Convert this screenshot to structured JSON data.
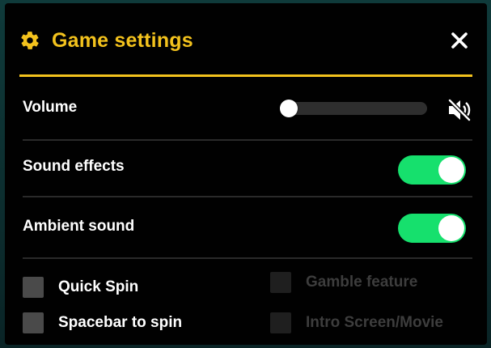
{
  "colors": {
    "accent": "#f3c21d",
    "toggle_on": "#16e06d",
    "panel_bg": "#010101",
    "checkbox_enabled": "#4a4a4a",
    "checkbox_disabled": "#1f1f1f",
    "label_disabled": "#3d3d3d"
  },
  "header": {
    "title": "Game settings",
    "icon": "gear-icon",
    "close_icon": "close-icon"
  },
  "settings": {
    "volume": {
      "label": "Volume",
      "level_percent": 0,
      "muted": true,
      "mute_icon": "speaker-muted-icon"
    },
    "sound_effects": {
      "label": "Sound effects",
      "on": true
    },
    "ambient_sound": {
      "label": "Ambient sound",
      "on": true
    }
  },
  "options": {
    "quick_spin": {
      "label": "Quick Spin",
      "checked": false,
      "enabled": true
    },
    "spacebar_to_spin": {
      "label": "Spacebar to spin",
      "checked": false,
      "enabled": true
    },
    "gamble_feature": {
      "label": "Gamble feature",
      "checked": false,
      "enabled": false
    },
    "intro_screen": {
      "label": "Intro Screen/Movie",
      "checked": false,
      "enabled": false
    }
  }
}
